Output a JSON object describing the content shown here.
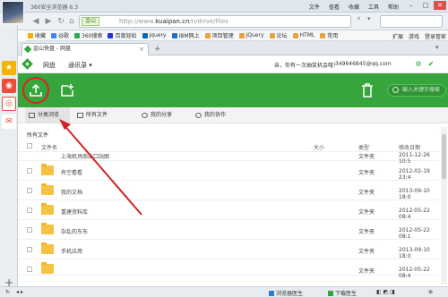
{
  "browser": {
    "title": "360安全浏览器 6.3",
    "menu": [
      "文件",
      "查看",
      "收藏",
      "工具",
      "帮助"
    ],
    "window_buttons": [
      "最小化",
      "最大化",
      "关闭"
    ],
    "secure_badge": "金山",
    "url_prefix": "http://www.",
    "url_host": "kuaipan.cn",
    "url_path": "/n/drive/files",
    "bookmarks": [
      "收藏",
      "谷歌",
      "360搜索",
      "百度轻松",
      "jquery",
      "IBM网上",
      "项目管理",
      "jQuery",
      "论坛",
      "HTML",
      "常用"
    ],
    "bookmarks_right": [
      "扩展",
      "游戏",
      "登录管家"
    ],
    "tab_label": "金山快盘 - 网盘",
    "status": {
      "left_icon": "refresh-icon",
      "browser_doctor": "浏览器医生",
      "download_doctor": "下载医生"
    }
  },
  "sidebar_icons": [
    "star-icon",
    "weibo-icon",
    "target-icon",
    "mail-icon"
  ],
  "app": {
    "nav": [
      "网盘",
      "通讯录"
    ],
    "nav_dropdown": "▾",
    "notice": "亲，你有一次抽奖机会哦！",
    "account": "349646845@qq.com",
    "search_placeholder": "输入关键字搜索",
    "view_tabs": [
      {
        "label": "分类浏览",
        "icon": "category-icon"
      },
      {
        "label": "所有文件",
        "icon": "files-icon"
      },
      {
        "label": "我的分享",
        "icon": "share-icon"
      },
      {
        "label": "我的协作",
        "icon": "team-icon"
      }
    ],
    "breadcrumb": "所有文件",
    "columns": {
      "name": "文件名",
      "size": "大小",
      "type": "类型",
      "date": "修改日期"
    },
    "files": [
      {
        "name": "上海机场南出口站图",
        "type": "文件夹",
        "date": "2011-12-26 10:5"
      },
      {
        "name": "有空看看",
        "type": "文件夹",
        "date": "2012-02-19 23:4"
      },
      {
        "name": "我的文档",
        "type": "文件夹",
        "date": "2013-09-10 18:0"
      },
      {
        "name": "重建资料库",
        "type": "文件夹",
        "date": "2012-05-22 08:4"
      },
      {
        "name": "杂乱的东东",
        "type": "文件夹",
        "date": "2012-05-22 08:1"
      },
      {
        "name": "手机应用",
        "type": "文件夹",
        "date": "2013-09-10 18:0"
      },
      {
        "name": "",
        "type": "文件夹",
        "date": "2012-05-22 08:4"
      }
    ]
  },
  "colors": {
    "brand_green": "#36a53b",
    "annotation_red": "#d22222"
  }
}
